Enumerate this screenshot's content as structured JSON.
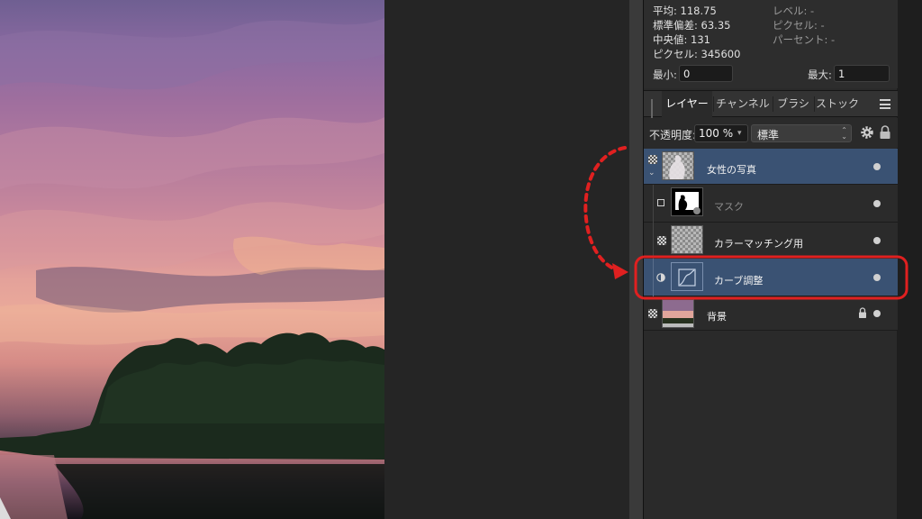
{
  "histogram": {
    "mean": "平均: 118.75",
    "std_dev": "標準偏差: 63.35",
    "median": "中央値: 131",
    "pixels": "ピクセル: 345600",
    "level": "レベル: -",
    "pixels_right": "ピクセル: -",
    "percent": "パーセント: -",
    "min_label": "最小:",
    "min_value": "0",
    "max_label": "最大:",
    "max_value": "1"
  },
  "tabs": [
    {
      "label": "レイヤー",
      "active": true
    },
    {
      "label": "チャンネル",
      "active": false
    },
    {
      "label": "ブラシ",
      "active": false
    },
    {
      "label": "ストック",
      "active": false
    }
  ],
  "opacity": {
    "label": "不透明度:",
    "value": "100 %",
    "blend_mode": "標準"
  },
  "layers": [
    {
      "name": "女性の写真",
      "selected": true,
      "visible": true
    },
    {
      "name": "マスク",
      "selected": false,
      "visible": true
    },
    {
      "name": "カラーマッチング用",
      "selected": false,
      "visible": true
    },
    {
      "name": "カーブ調整",
      "selected": true,
      "visible": true
    },
    {
      "name": "背景",
      "selected": false,
      "visible": true,
      "locked": true
    }
  ],
  "colors": {
    "selection": "#3a5273",
    "annotation": "#e02020"
  },
  "icons": [
    "gear-icon",
    "lock-icon",
    "menu-icon",
    "curves-icon",
    "chevron-down-icon"
  ]
}
